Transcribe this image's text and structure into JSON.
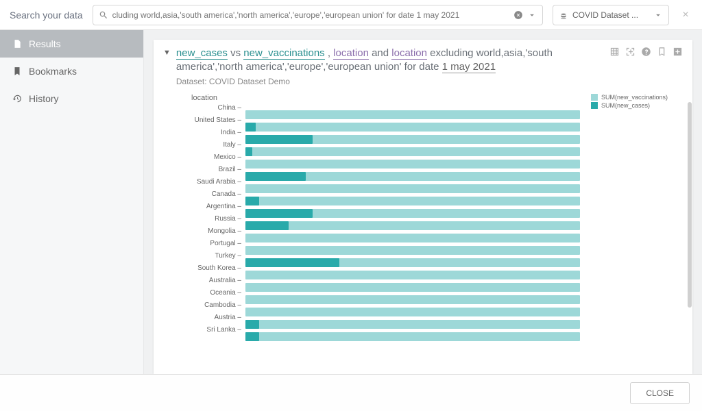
{
  "topbar": {
    "label": "Search your data",
    "query": "cluding world,asia,'south america','north america','europe','european union' for date 1 may 2021",
    "dataset": "COVID Dataset ..."
  },
  "sidebar": {
    "items": [
      {
        "label": "Results",
        "icon": "file"
      },
      {
        "label": "Bookmarks",
        "icon": "bookmark"
      },
      {
        "label": "History",
        "icon": "history"
      }
    ]
  },
  "card": {
    "title_parts": {
      "p1": "new_cases",
      "p2": " vs ",
      "p3": "new_vaccinations",
      "p4": " , ",
      "p5": "location",
      "p6": " and ",
      "p7": "location",
      "p8": " excluding world,asia,'south america','north america','europe','european union' for date ",
      "p9": "1 may 2021"
    },
    "dataset_label": "Dataset: COVID Dataset Demo"
  },
  "legend": {
    "a": "SUM(new_vaccinations)",
    "b": "SUM(new_cases)"
  },
  "colors": {
    "light": "#9dd8d8",
    "dark": "#29aaaa"
  },
  "footer": {
    "close": "CLOSE"
  },
  "chart_data": {
    "type": "bar",
    "title": "new_cases vs new_vaccinations by location",
    "xlabel": "",
    "ylabel": "location",
    "categories": [
      "China",
      "United States",
      "India",
      "Italy",
      "Mexico",
      "Brazil",
      "Saudi Arabia",
      "Canada",
      "Argentina",
      "Russia",
      "Mongolia",
      "Portugal",
      "Turkey",
      "South Korea",
      "Australia",
      "Oceania",
      "Cambodia",
      "Austria",
      "Sri Lanka"
    ],
    "series": [
      {
        "name": "SUM(new_vaccinations)",
        "values": [
          100,
          100,
          100,
          100,
          100,
          100,
          100,
          100,
          100,
          100,
          100,
          100,
          100,
          100,
          100,
          100,
          100,
          100,
          100
        ]
      },
      {
        "name": "SUM(new_cases)",
        "values": [
          0,
          3,
          20,
          2,
          0,
          18,
          0,
          4,
          20,
          13,
          0,
          0,
          28,
          0,
          0,
          0,
          0,
          4,
          4
        ]
      }
    ],
    "xlim": [
      0,
      100
    ],
    "legend_position": "right",
    "orientation": "horizontal",
    "note": "values are relative percentages of the full bar width as read from the screenshot; no numeric axis ticks were visible"
  }
}
